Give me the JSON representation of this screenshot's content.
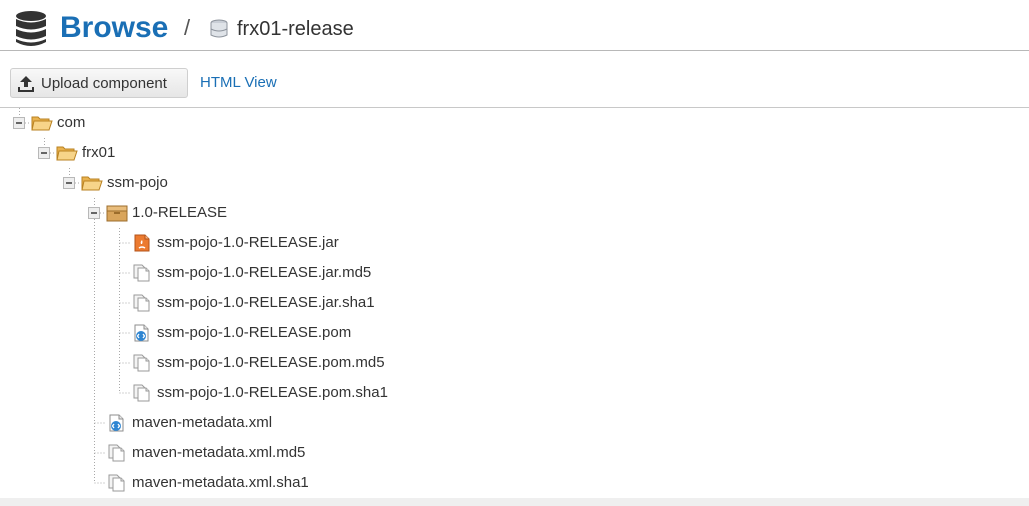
{
  "header": {
    "title": "Browse",
    "separator": "/",
    "repository": "frx01-release"
  },
  "toolbar": {
    "upload_label": "Upload component",
    "html_view_label": "HTML View"
  },
  "tree": {
    "com": "com",
    "frx01": "frx01",
    "ssm_pojo": "ssm-pojo",
    "version": "1.0-RELEASE",
    "jar": "ssm-pojo-1.0-RELEASE.jar",
    "jar_md5": "ssm-pojo-1.0-RELEASE.jar.md5",
    "jar_sha1": "ssm-pojo-1.0-RELEASE.jar.sha1",
    "pom": "ssm-pojo-1.0-RELEASE.pom",
    "pom_md5": "ssm-pojo-1.0-RELEASE.pom.md5",
    "pom_sha1": "ssm-pojo-1.0-RELEASE.pom.sha1",
    "metadata": "maven-metadata.xml",
    "metadata_md5": "maven-metadata.xml.md5",
    "metadata_sha1": "maven-metadata.xml.sha1"
  },
  "icons": {
    "database": "database-icon",
    "repository": "repository-icon",
    "upload": "upload-icon",
    "folder": "folder-open-icon",
    "package": "package-icon",
    "jar": "jar-file-icon",
    "xml": "xml-file-icon",
    "checksum": "checksum-file-icon"
  },
  "colors": {
    "accent": "#1a6fb5",
    "folder": "#f2c46c",
    "package": "#d9a55c",
    "jar": "#e8732e"
  }
}
